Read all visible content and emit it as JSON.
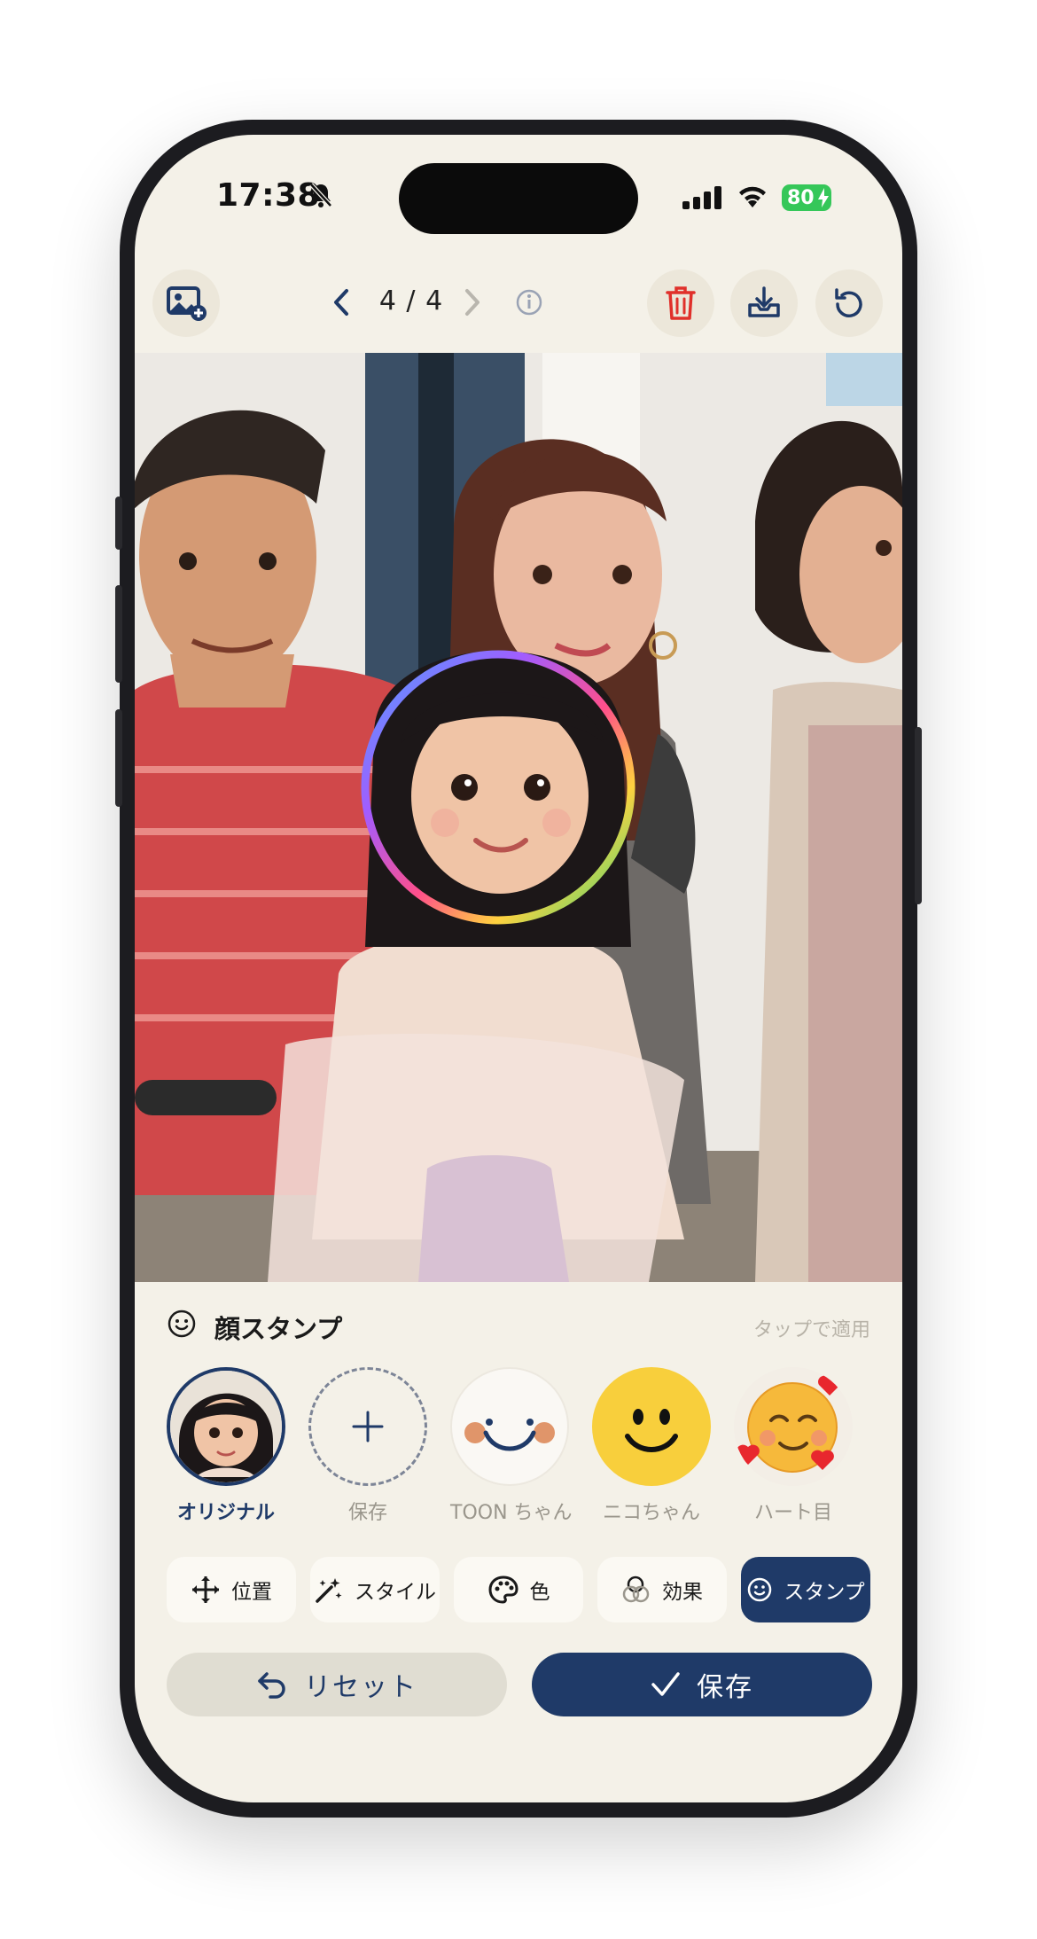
{
  "status": {
    "time": "17:38",
    "battery": "80"
  },
  "toolbar": {
    "counter": "4 / 4"
  },
  "panel": {
    "title": "顔スタンプ",
    "hint": "タップで適用"
  },
  "stamps": [
    {
      "label": "オリジナル",
      "selected": true
    },
    {
      "label": "保存"
    },
    {
      "label": "TOON ちゃん"
    },
    {
      "label": "ニコちゃん"
    },
    {
      "label": "ハート目"
    }
  ],
  "tools": [
    {
      "label": "位置",
      "icon": "move-icon"
    },
    {
      "label": "スタイル",
      "icon": "magic-wand-icon"
    },
    {
      "label": "色",
      "icon": "palette-icon"
    },
    {
      "label": "効果",
      "icon": "effects-icon"
    },
    {
      "label": "スタンプ",
      "icon": "smile-icon",
      "active": true
    }
  ],
  "actions": {
    "reset": "リセット",
    "save": "保存"
  },
  "colors": {
    "primary": "#1f3a68",
    "background": "#f4f1e8",
    "delete": "#e0302b"
  }
}
